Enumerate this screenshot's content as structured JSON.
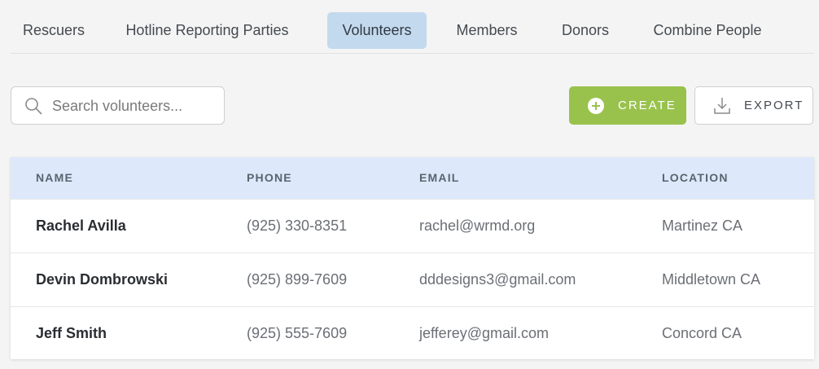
{
  "tabs": [
    {
      "label": "Rescuers",
      "active": false
    },
    {
      "label": "Hotline Reporting Parties",
      "active": false
    },
    {
      "label": "Volunteers",
      "active": true
    },
    {
      "label": "Members",
      "active": false
    },
    {
      "label": "Donors",
      "active": false
    },
    {
      "label": "Combine People",
      "active": false
    }
  ],
  "search": {
    "placeholder": "Search volunteers...",
    "value": "",
    "icon": "search-icon"
  },
  "actions": {
    "create_label": "CREATE",
    "create_icon": "plus-circle-icon",
    "export_label": "EXPORT",
    "export_icon": "download-icon"
  },
  "table": {
    "columns": [
      "NAME",
      "PHONE",
      "EMAIL",
      "LOCATION"
    ],
    "rows": [
      [
        "Rachel Avilla",
        "(925) 330-8351",
        "rachel@wrmd.org",
        "Martinez CA"
      ],
      [
        "Devin Dombrowski",
        "(925) 899-7609",
        "dddesigns3@gmail.com",
        "Middletown CA"
      ],
      [
        "Jeff Smith",
        "(925) 555-7609",
        "jefferey@gmail.com",
        "Concord CA"
      ]
    ]
  },
  "colors": {
    "active_tab": "#c3d9ee",
    "create_button": "#99c24d",
    "table_header": "#dde9fb"
  }
}
